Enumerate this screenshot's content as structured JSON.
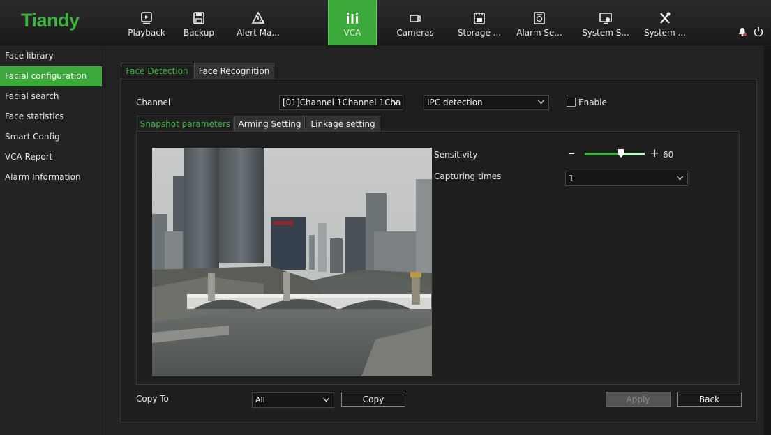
{
  "app": {
    "logo": "Tiandy"
  },
  "nav": {
    "items": [
      {
        "label": "Playback",
        "icon": "playback-icon"
      },
      {
        "label": "Backup",
        "icon": "save-icon"
      },
      {
        "label": "Alert Ma...",
        "icon": "alert-icon"
      },
      {
        "label": "VCA",
        "icon": "vca-icon",
        "active": true
      },
      {
        "label": "Cameras",
        "icon": "camera-icon"
      },
      {
        "label": "Storage ...",
        "icon": "storage-icon"
      },
      {
        "label": "Alarm Se...",
        "icon": "alarm-settings-icon"
      },
      {
        "label": "System S...",
        "icon": "system-settings-icon"
      },
      {
        "label": "System ...",
        "icon": "tools-icon"
      }
    ],
    "right_icons": [
      "bell-icon",
      "power-icon"
    ]
  },
  "sidebar": {
    "items": [
      {
        "label": "Face library"
      },
      {
        "label": "Facial configuration",
        "active": true
      },
      {
        "label": "Facial search"
      },
      {
        "label": "Face statistics"
      },
      {
        "label": "Smart Config"
      },
      {
        "label": "VCA Report"
      },
      {
        "label": "Alarm Information"
      }
    ]
  },
  "tabs": {
    "main": [
      {
        "label": "Face Detection",
        "active": true
      },
      {
        "label": "Face Recognition"
      }
    ],
    "sub": [
      {
        "label": "Snapshot parameters",
        "active": true
      },
      {
        "label": "Arming Setting"
      },
      {
        "label": "Linkage setting"
      }
    ]
  },
  "form": {
    "channel_label": "Channel",
    "channel_value": "[01]Channel 1Channel 1Cha",
    "detection_value": "IPC detection",
    "enable_label": "Enable",
    "enable_checked": false,
    "sensitivity_label": "Sensitivity",
    "sensitivity_value": "60",
    "sensitivity_fraction": 0.6,
    "capturing_label": "Capturing times",
    "capturing_value": "1",
    "copy_to_label": "Copy To",
    "copy_to_value": "All",
    "copy_button": "Copy",
    "apply_button": "Apply",
    "back_button": "Back"
  },
  "colors": {
    "accent": "#3db23d",
    "background": "#1f1f1f"
  }
}
